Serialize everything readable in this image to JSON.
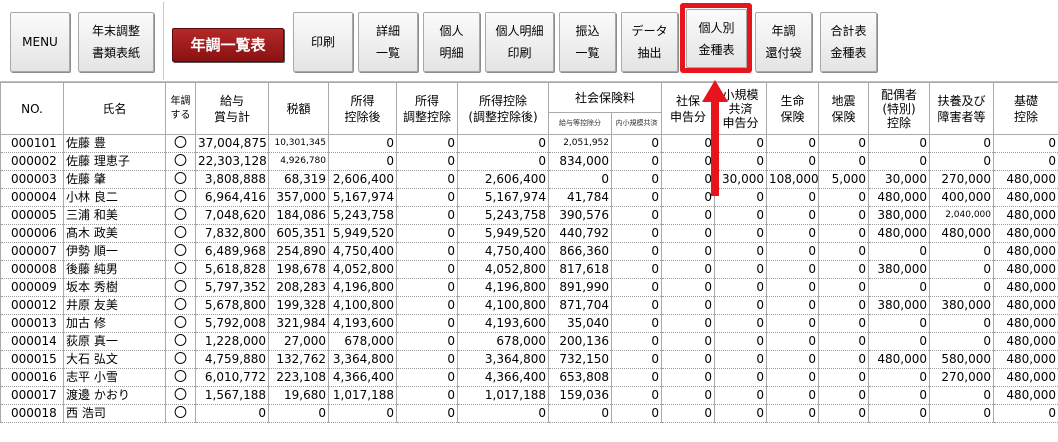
{
  "toolbar": {
    "menu": "MENU",
    "nenmatsu_l1": "年末調整",
    "nenmatsu_l2": "書類表紙",
    "ichiran": "年調一覧表",
    "print": "印刷",
    "detail_l1": "詳細",
    "detail_l2": "一覧",
    "personal_l1": "個人",
    "personal_l2": "明細",
    "personal_print_l1": "個人明細",
    "personal_print_l2": "印刷",
    "transfer_l1": "振込",
    "transfer_l2": "一覧",
    "data_l1": "データ",
    "data_l2": "抽出",
    "kojinbetsu_l1": "個人別",
    "kojinbetsu_l2": "金種表",
    "refund_l1": "年調",
    "refund_l2": "還付袋",
    "total_l1": "合計表",
    "total_l2": "金種表"
  },
  "annotation": {
    "highlight_color": "#e8141c"
  },
  "table": {
    "headers": {
      "no": "NO.",
      "name": "氏名",
      "nencho_l1": "年調",
      "nencho_l2": "する",
      "salary_l1": "給与",
      "salary_l2": "賞与計",
      "tax": "税額",
      "income_l1": "所得",
      "income_l2": "控除後",
      "adjust_l1": "所得",
      "adjust_l2": "調整控除",
      "income_deduct_l1": "所得控除",
      "income_deduct_l2": "(調整控除後)",
      "social": "社会保険料",
      "social_sub1": "給与等控除分",
      "social_sub2": "内小規模共済",
      "shaho_l1": "社保",
      "shaho_l2": "申告分",
      "small_l1": "小規模",
      "small_l2": "共済",
      "small_l3": "申告分",
      "life_l1": "生命",
      "life_l2": "保険",
      "quake_l1": "地震",
      "quake_l2": "保険",
      "spouse_l1": "配偶者",
      "spouse_l2": "(特別)",
      "spouse_l3": "控除",
      "dependents_l1": "扶養及び",
      "dependents_l2": "障害者等",
      "basic_l1": "基礎",
      "basic_l2": "控除"
    },
    "rows": [
      {
        "no": "000101",
        "name": "佐藤 豊",
        "flag": "〇",
        "salary": "37,004,875",
        "tax": "10,301,345",
        "income": "0",
        "adjust": "0",
        "deduct": "0",
        "social": "2,051,952",
        "small_in": "0",
        "shaho": "0",
        "kyosai": "0",
        "life": "0",
        "quake": "0",
        "spouse": "0",
        "dep": "0",
        "basic": "0"
      },
      {
        "no": "000002",
        "name": "佐藤 理恵子",
        "flag": "〇",
        "salary": "22,303,128",
        "tax": "4,926,780",
        "income": "0",
        "adjust": "0",
        "deduct": "0",
        "social": "834,000",
        "small_in": "0",
        "shaho": "0",
        "kyosai": "0",
        "life": "0",
        "quake": "0",
        "spouse": "0",
        "dep": "0",
        "basic": "0"
      },
      {
        "no": "000003",
        "name": "佐藤 肇",
        "flag": "〇",
        "salary": "3,808,888",
        "tax": "68,319",
        "income": "2,606,400",
        "adjust": "0",
        "deduct": "2,606,400",
        "social": "0",
        "small_in": "0",
        "shaho": "0",
        "kyosai": "30,000",
        "life": "108,000",
        "quake": "5,000",
        "spouse": "30,000",
        "dep": "270,000",
        "basic": "480,000"
      },
      {
        "no": "000004",
        "name": "小林 良二",
        "flag": "〇",
        "salary": "6,964,416",
        "tax": "357,000",
        "income": "5,167,974",
        "adjust": "0",
        "deduct": "5,167,974",
        "social": "41,784",
        "small_in": "0",
        "shaho": "0",
        "kyosai": "0",
        "life": "0",
        "quake": "0",
        "spouse": "480,000",
        "dep": "400,000",
        "basic": "480,000"
      },
      {
        "no": "000005",
        "name": "三浦 和美",
        "flag": "〇",
        "salary": "7,048,620",
        "tax": "184,086",
        "income": "5,243,758",
        "adjust": "0",
        "deduct": "5,243,758",
        "social": "390,576",
        "small_in": "0",
        "shaho": "0",
        "kyosai": "0",
        "life": "0",
        "quake": "0",
        "spouse": "380,000",
        "dep": "2,040,000",
        "basic": "480,000"
      },
      {
        "no": "000006",
        "name": "髙木 政美",
        "flag": "〇",
        "salary": "7,832,800",
        "tax": "605,351",
        "income": "5,949,520",
        "adjust": "0",
        "deduct": "5,949,520",
        "social": "440,792",
        "small_in": "0",
        "shaho": "0",
        "kyosai": "0",
        "life": "0",
        "quake": "0",
        "spouse": "480,000",
        "dep": "480,000",
        "basic": "480,000"
      },
      {
        "no": "000007",
        "name": "伊勢 順一",
        "flag": "〇",
        "salary": "6,489,968",
        "tax": "254,890",
        "income": "4,750,400",
        "adjust": "0",
        "deduct": "4,750,400",
        "social": "866,360",
        "small_in": "0",
        "shaho": "0",
        "kyosai": "0",
        "life": "0",
        "quake": "0",
        "spouse": "0",
        "dep": "0",
        "basic": "480,000"
      },
      {
        "no": "000008",
        "name": "後藤 純男",
        "flag": "〇",
        "salary": "5,618,828",
        "tax": "198,678",
        "income": "4,052,800",
        "adjust": "0",
        "deduct": "4,052,800",
        "social": "817,618",
        "small_in": "0",
        "shaho": "0",
        "kyosai": "0",
        "life": "0",
        "quake": "0",
        "spouse": "380,000",
        "dep": "0",
        "basic": "480,000"
      },
      {
        "no": "000009",
        "name": "坂本 秀樹",
        "flag": "〇",
        "salary": "5,797,352",
        "tax": "208,283",
        "income": "4,196,800",
        "adjust": "0",
        "deduct": "4,196,800",
        "social": "891,990",
        "small_in": "0",
        "shaho": "0",
        "kyosai": "0",
        "life": "0",
        "quake": "0",
        "spouse": "0",
        "dep": "0",
        "basic": "480,000"
      },
      {
        "no": "000012",
        "name": "井原 友美",
        "flag": "〇",
        "salary": "5,678,800",
        "tax": "199,328",
        "income": "4,100,800",
        "adjust": "0",
        "deduct": "4,100,800",
        "social": "871,704",
        "small_in": "0",
        "shaho": "0",
        "kyosai": "0",
        "life": "0",
        "quake": "0",
        "spouse": "380,000",
        "dep": "380,000",
        "basic": "480,000"
      },
      {
        "no": "000013",
        "name": "加古 修",
        "flag": "〇",
        "salary": "5,792,008",
        "tax": "321,984",
        "income": "4,193,600",
        "adjust": "0",
        "deduct": "4,193,600",
        "social": "35,040",
        "small_in": "0",
        "shaho": "0",
        "kyosai": "0",
        "life": "0",
        "quake": "0",
        "spouse": "0",
        "dep": "0",
        "basic": "480,000"
      },
      {
        "no": "000014",
        "name": "荻原 真一",
        "flag": "〇",
        "salary": "1,228,000",
        "tax": "27,000",
        "income": "678,000",
        "adjust": "0",
        "deduct": "678,000",
        "social": "200,136",
        "small_in": "0",
        "shaho": "0",
        "kyosai": "0",
        "life": "0",
        "quake": "0",
        "spouse": "0",
        "dep": "0",
        "basic": "480,000"
      },
      {
        "no": "000015",
        "name": "大石 弘文",
        "flag": "〇",
        "salary": "4,759,880",
        "tax": "132,762",
        "income": "3,364,800",
        "adjust": "0",
        "deduct": "3,364,800",
        "social": "732,150",
        "small_in": "0",
        "shaho": "0",
        "kyosai": "0",
        "life": "0",
        "quake": "0",
        "spouse": "480,000",
        "dep": "580,000",
        "basic": "480,000"
      },
      {
        "no": "000016",
        "name": "志平 小雪",
        "flag": "〇",
        "salary": "6,010,772",
        "tax": "223,108",
        "income": "4,366,400",
        "adjust": "0",
        "deduct": "4,366,400",
        "social": "653,808",
        "small_in": "0",
        "shaho": "0",
        "kyosai": "0",
        "life": "0",
        "quake": "0",
        "spouse": "0",
        "dep": "270,000",
        "basic": "480,000"
      },
      {
        "no": "000017",
        "name": "渡邊 かおり",
        "flag": "〇",
        "salary": "1,567,188",
        "tax": "19,680",
        "income": "1,017,188",
        "adjust": "0",
        "deduct": "1,017,188",
        "social": "159,036",
        "small_in": "0",
        "shaho": "0",
        "kyosai": "0",
        "life": "0",
        "quake": "0",
        "spouse": "0",
        "dep": "0",
        "basic": "480,000"
      },
      {
        "no": "000018",
        "name": "西 浩司",
        "flag": "〇",
        "salary": "0",
        "tax": "0",
        "income": "0",
        "adjust": "0",
        "deduct": "0",
        "social": "0",
        "small_in": "0",
        "shaho": "0",
        "kyosai": "0",
        "life": "0",
        "quake": "0",
        "spouse": "0",
        "dep": "0",
        "basic": "0"
      }
    ]
  }
}
